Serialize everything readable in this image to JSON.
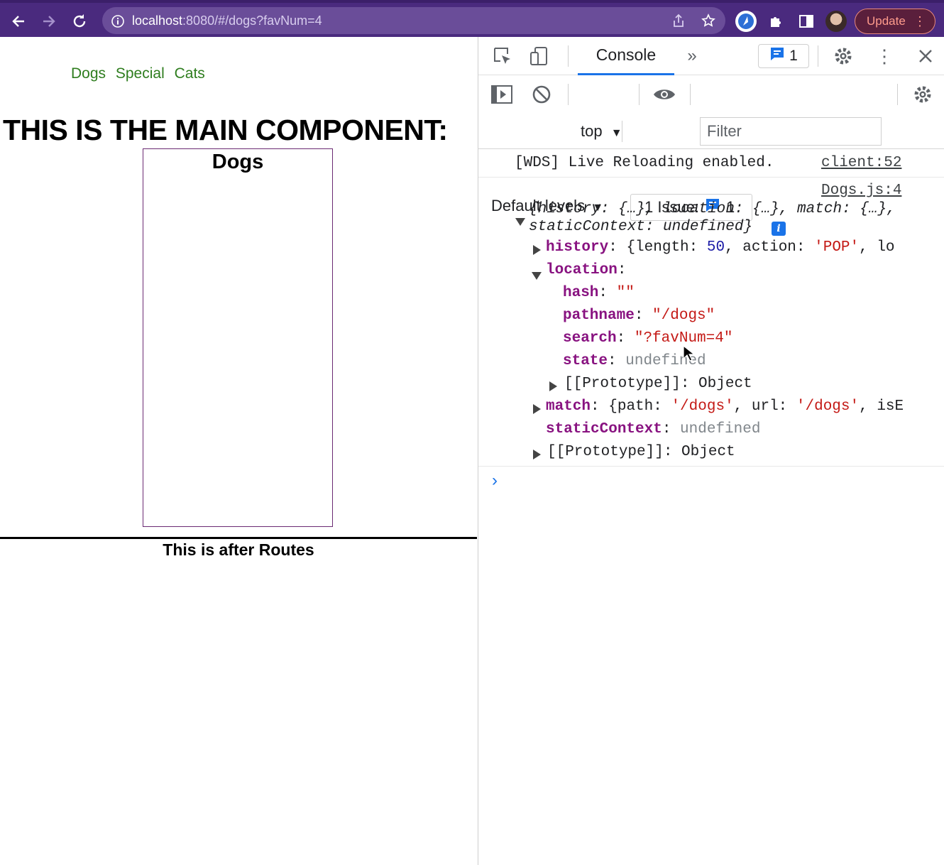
{
  "browser": {
    "url_host": "localhost",
    "url_path": ":8080/#/dogs?favNum=4",
    "update_label": "Update"
  },
  "page": {
    "nav_links": [
      "Dogs",
      "Special",
      "Cats"
    ],
    "main_heading": "THIS IS THE MAIN COMPONENT:",
    "dogs_title": "Dogs",
    "after_routes": "This is after Routes"
  },
  "devtools": {
    "tab_console": "Console",
    "message_count": "1",
    "context": "top",
    "filter_placeholder": "Filter",
    "default_levels": "Default levels",
    "issues_label": "1 Issue:",
    "issues_count": "1",
    "console": {
      "wds_message": "[WDS] Live Reloading enabled.",
      "wds_source": "client:52",
      "log_source": "Dogs.js:4",
      "summary_line1": "{history: {…}, location: {…}, match: {…},",
      "summary_line2": "staticContext: undefined}",
      "history_key": "history",
      "history_val_1": "{length: ",
      "history_num": "50",
      "history_val_2": ", action: ",
      "history_str": "'POP'",
      "history_val_3": ", lo",
      "location_key": "location",
      "hash_key": "hash",
      "hash_val": "\"\"",
      "pathname_key": "pathname",
      "pathname_val": "\"/dogs\"",
      "search_key": "search",
      "search_val": "\"?favNum=4\"",
      "state_key": "state",
      "state_val": "undefined",
      "proto_inner": "[[Prototype]]",
      "proto_inner_val": "Object",
      "match_key": "match",
      "match_val_1": "{path: ",
      "match_str_1": "'/dogs'",
      "match_val_2": ", url: ",
      "match_str_2": "'/dogs'",
      "match_val_3": ", isE",
      "static_key": "staticContext",
      "static_val": "undefined",
      "proto_outer": "[[Prototype]]",
      "proto_outer_val": "Object",
      "prompt": "›"
    }
  },
  "icons": [
    "back-arrow-icon",
    "forward-arrow-icon",
    "reload-icon",
    "info-icon",
    "share-icon",
    "star-icon",
    "extension-icon",
    "puzzle-icon",
    "sidebar-icon",
    "avatar",
    "kebab-icon",
    "inspect-icon",
    "device-toolbar-icon",
    "more-tabs-icon",
    "message-icon",
    "gear-icon",
    "close-icon",
    "sidebar-toggle-icon",
    "clear-icon",
    "eye-icon"
  ],
  "colors": {
    "browser_frame": "#4a2a7e",
    "link_green": "#2e7d1e",
    "box_border": "#6b2a73",
    "accent_blue": "#1a73e8",
    "key_purple": "#881280",
    "string_red": "#c41a16",
    "number_blue": "#1a1aa6"
  }
}
